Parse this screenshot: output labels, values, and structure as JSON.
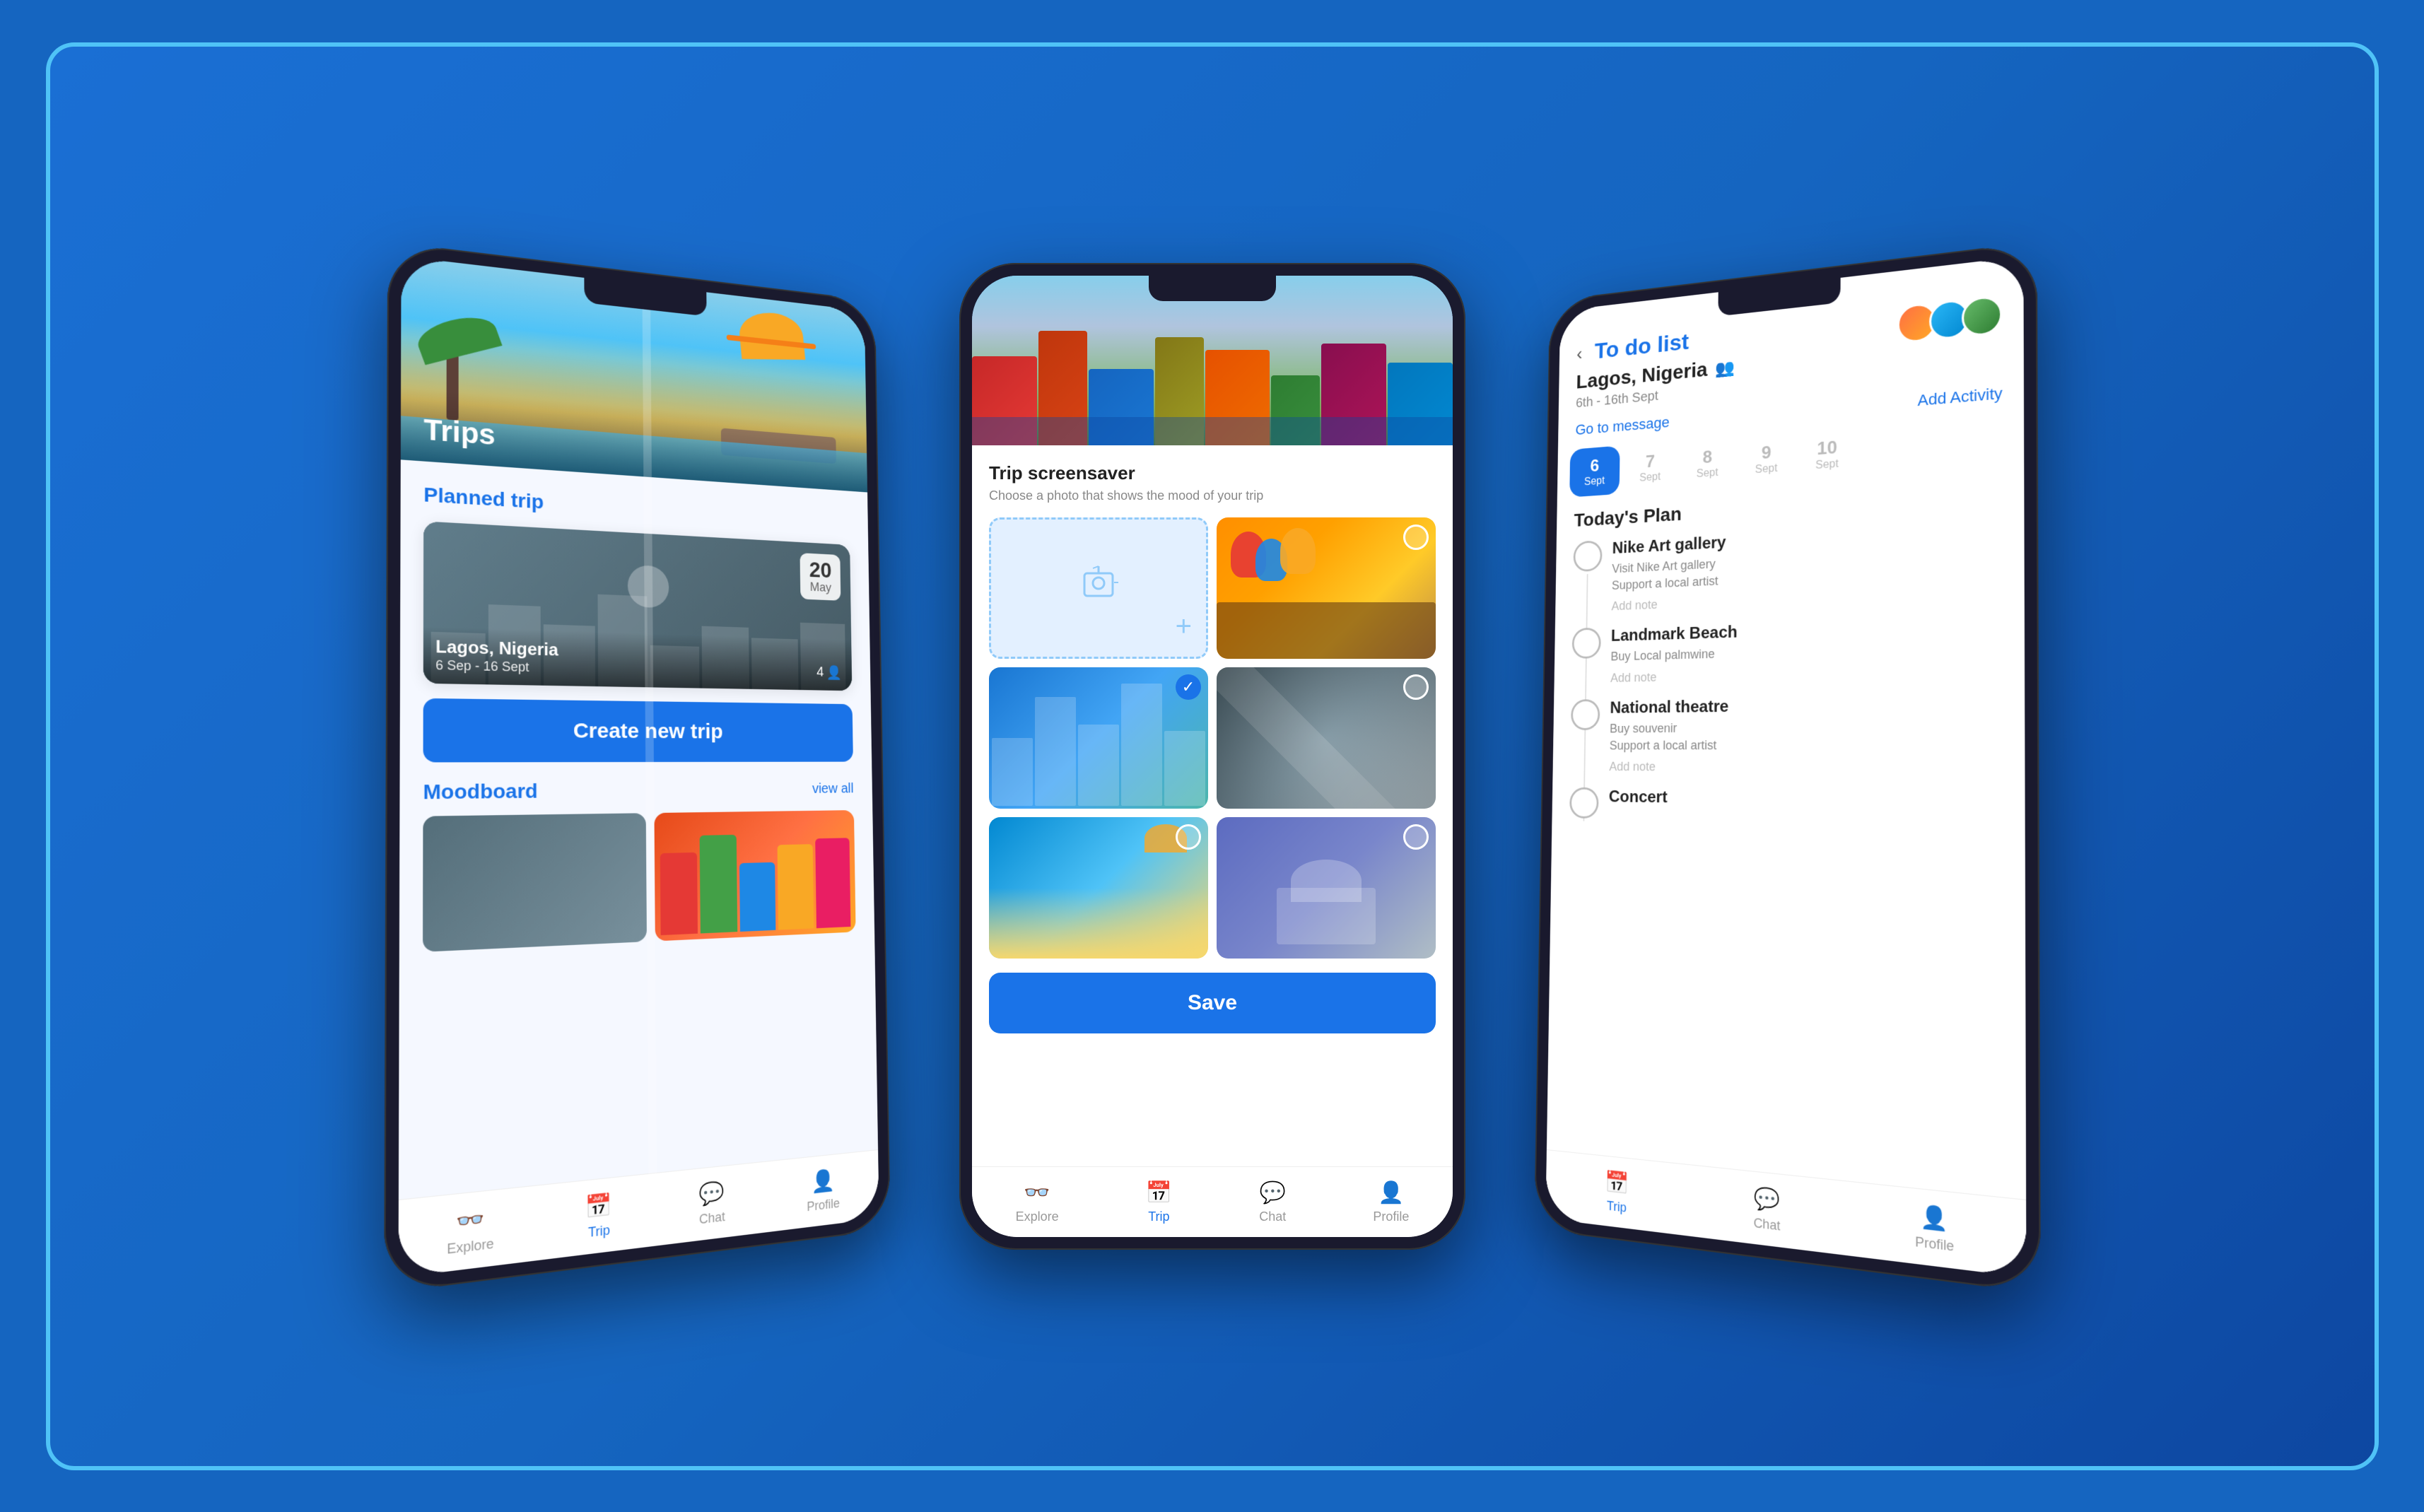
{
  "background": {
    "outer_color": "#1565c0",
    "inner_color": "#1a6fd4"
  },
  "phone1": {
    "hero_title": "Trips",
    "section_planned": "Planned trip",
    "trip": {
      "name": "Lagos, Nigeria",
      "dates": "6 Sep - 16 Sept",
      "date_num": "20",
      "date_month": "May",
      "people_count": "4"
    },
    "create_btn": "Create new trip",
    "moodboard_title": "Moodboard",
    "view_all": "view all",
    "nav": {
      "explore": "Explore",
      "trip": "Trip",
      "chat": "Chat",
      "profile": "Profile"
    }
  },
  "phone2": {
    "title": "Trip screensaver",
    "subtitle": "Choose a photo that shows the mood of your trip",
    "save_btn": "Save",
    "nav": {
      "explore": "Explore",
      "trip": "Trip",
      "chat": "Chat",
      "profile": "Profile"
    }
  },
  "phone3": {
    "back_label": "‹",
    "title": "To do list",
    "trip_name": "Lagos, Nigeria",
    "trip_icon": "👥",
    "trip_dates": "6th - 16th Sept",
    "go_to_message": "Go to message",
    "add_activity": "Add Activity",
    "dates": [
      {
        "num": "6",
        "label": "Sept",
        "active": true
      },
      {
        "num": "7",
        "label": "Sept",
        "active": false
      },
      {
        "num": "8",
        "label": "Sept",
        "active": false
      },
      {
        "num": "9",
        "label": "Sept",
        "active": false
      },
      {
        "num": "10",
        "label": "Sept",
        "active": false
      }
    ],
    "today_plan": "Today's  Plan",
    "activities": [
      {
        "name": "Nike Art gallery",
        "desc1": "Visit Nike Art gallery",
        "desc2": "Support a local artist",
        "add_note": "Add note"
      },
      {
        "name": "Landmark Beach",
        "desc1": "Buy Local palmwine",
        "desc2": "",
        "add_note": "Add note"
      },
      {
        "name": "National theatre",
        "desc1": "Buy souvenir",
        "desc2": "Support a local artist",
        "add_note": "Add note"
      },
      {
        "name": "Concert",
        "desc1": "",
        "desc2": "",
        "add_note": ""
      }
    ],
    "nav": {
      "trip": "Trip",
      "chat": "Chat",
      "profile": "Profile"
    }
  }
}
